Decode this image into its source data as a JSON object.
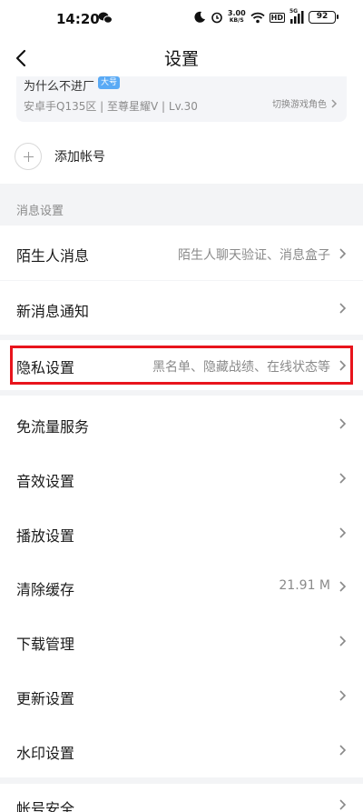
{
  "status_bar": {
    "time": "14:20",
    "net_speed_value": "3.00",
    "net_speed_unit": "KB/S",
    "hd_label": "HD",
    "network_type": "5G",
    "battery": "92"
  },
  "header": {
    "title": "设置"
  },
  "account": {
    "name": "为什么不进厂",
    "badge": "大号",
    "detail": "安卓手Q135区 | 至尊星耀V | Lv.30",
    "switch_role": "切换游戏角色",
    "add_account": "添加帐号"
  },
  "message_section": {
    "title": "消息设置"
  },
  "settings": {
    "stranger": {
      "label": "陌生人消息",
      "value": "陌生人聊天验证、消息盒子"
    },
    "notifications": {
      "label": "新消息通知"
    },
    "privacy": {
      "label": "隐私设置",
      "value": "黑名单、隐藏战绩、在线状态等"
    },
    "free_data": {
      "label": "免流量服务"
    },
    "sound": {
      "label": "音效设置"
    },
    "playback": {
      "label": "播放设置"
    },
    "cache": {
      "label": "清除缓存",
      "value": "21.91 M"
    },
    "downloads": {
      "label": "下载管理"
    },
    "update": {
      "label": "更新设置"
    },
    "watermark": {
      "label": "水印设置"
    },
    "account_security": {
      "label": "帐号安全"
    }
  },
  "colors": {
    "highlight_border": "#e8141c",
    "badge_bg": "#5aaaf5",
    "page_bg": "#f3f4f6"
  }
}
